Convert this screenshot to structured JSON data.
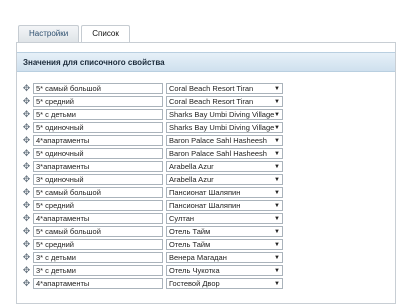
{
  "tabs": [
    {
      "label": "Настройки",
      "active": false
    },
    {
      "label": "Список",
      "active": true
    }
  ],
  "panel": {
    "title": "Значения для списочного свойства"
  },
  "icons": {
    "drag_handle": "move-arrows-icon",
    "dropdown": "chevron-down-icon"
  },
  "rows": [
    {
      "value": "5* самый большой",
      "hotel": "Coral Beach Resort Tiran"
    },
    {
      "value": "5* средний",
      "hotel": "Coral Beach Resort Tiran"
    },
    {
      "value": "5* с детьми",
      "hotel": "Sharks Bay Umbi Diving Village"
    },
    {
      "value": "5* одиночный",
      "hotel": "Sharks Bay Umbi Diving Village"
    },
    {
      "value": "4*апартаменты",
      "hotel": "Baron Palace Sahl Hasheesh"
    },
    {
      "value": "5* одиночный",
      "hotel": "Baron Palace Sahl Hasheesh"
    },
    {
      "value": "3*апартаменты",
      "hotel": "Arabella Azur"
    },
    {
      "value": "3* одиночный",
      "hotel": "Arabella Azur"
    },
    {
      "value": "5* самый большой",
      "hotel": "Пансионат Шаляпин"
    },
    {
      "value": "5* средний",
      "hotel": "Пансионат Шаляпин"
    },
    {
      "value": "4*апартаменты",
      "hotel": "Султан"
    },
    {
      "value": "5* самый большой",
      "hotel": "Отель Тайм"
    },
    {
      "value": "5* средний",
      "hotel": "Отель Тайм"
    },
    {
      "value": "3* с детьми",
      "hotel": "Венера Магадан"
    },
    {
      "value": "3* с детьми",
      "hotel": "Отель Чукотка"
    },
    {
      "value": "4*апартаменты",
      "hotel": "Гостевой Двор"
    }
  ]
}
